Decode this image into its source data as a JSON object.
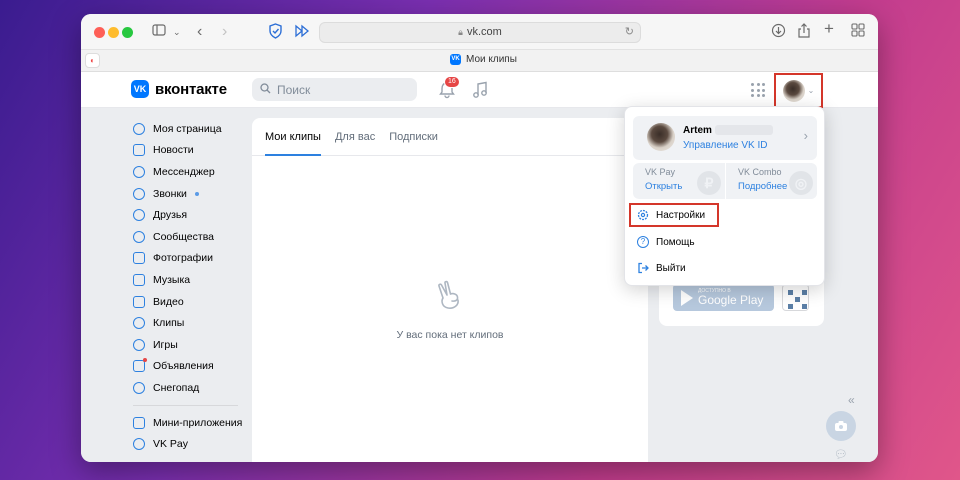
{
  "browser": {
    "url": "vk.com",
    "tab_title": "Мои клипы"
  },
  "header": {
    "logo_text": "вконтакте",
    "search_placeholder": "Поиск",
    "notification_count": "16"
  },
  "sidebar": {
    "items": [
      {
        "label": "Моя страница",
        "icon": "user-circle-icon"
      },
      {
        "label": "Новости",
        "icon": "news-icon"
      },
      {
        "label": "Мессенджер",
        "icon": "message-icon"
      },
      {
        "label": "Звонки",
        "icon": "phone-icon"
      },
      {
        "label": "Друзья",
        "icon": "friends-icon"
      },
      {
        "label": "Сообщества",
        "icon": "communities-icon"
      },
      {
        "label": "Фотографии",
        "icon": "photo-icon"
      },
      {
        "label": "Музыка",
        "icon": "music-icon"
      },
      {
        "label": "Видео",
        "icon": "video-icon"
      },
      {
        "label": "Клипы",
        "icon": "clips-icon"
      },
      {
        "label": "Игры",
        "icon": "games-icon"
      },
      {
        "label": "Объявления",
        "icon": "ads-icon"
      },
      {
        "label": "Снегопад",
        "icon": "snowflake-icon"
      }
    ],
    "extra_items": [
      {
        "label": "Мини-приложения",
        "icon": "apps-icon"
      },
      {
        "label": "VK Pay",
        "icon": "vkpay-icon"
      }
    ]
  },
  "main": {
    "tabs": [
      "Мои клипы",
      "Для вас",
      "Подписки"
    ],
    "empty_text": "У вас пока нет клипов"
  },
  "promo": {
    "gplay_small": "ДОСТУПНО В",
    "gplay_big": "Google Play"
  },
  "dropdown": {
    "name": "Artem",
    "manage": "Управление VK ID",
    "vkpay_title": "VK Pay",
    "vkpay_action": "Открыть",
    "combo_title": "VK Combo",
    "combo_action": "Подробнее",
    "settings": "Настройки",
    "help": "Помощь",
    "logout": "Выйти"
  },
  "colors": {
    "accent": "#2d81e0",
    "highlight": "#d4362a",
    "badge": "#e64646"
  }
}
